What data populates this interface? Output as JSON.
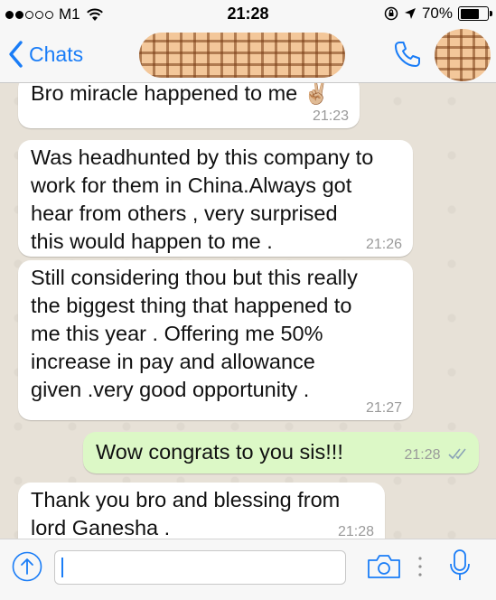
{
  "status_bar": {
    "carrier": "M1",
    "time": "21:28",
    "battery_percent": "70%",
    "battery_level": 0.7
  },
  "nav": {
    "back_label": "Chats"
  },
  "messages": [
    {
      "direction": "in",
      "lines": [
        "Bro miracle happened to me ✌🏼"
      ],
      "time": "21:23"
    },
    {
      "direction": "in",
      "lines": [
        "Was headhunted by this company to",
        "work for them in China.Always got",
        "hear from others , very surprised",
        "this would happen to me ."
      ],
      "time": "21:26"
    },
    {
      "direction": "in",
      "lines": [
        "Still considering thou but this really",
        "the biggest thing that happened to",
        "me this year . Offering me 50%",
        "increase in pay and allowance",
        "given .very good opportunity ."
      ],
      "time": "21:27"
    },
    {
      "direction": "out",
      "lines": [
        "Wow congrats to you sis!!!"
      ],
      "time": "21:28",
      "status": "read"
    },
    {
      "direction": "in",
      "lines": [
        "Thank you bro and blessing from",
        "lord Ganesha ."
      ],
      "time": "21:28"
    }
  ],
  "input": {
    "placeholder": ""
  },
  "colors": {
    "accent": "#1a7df7",
    "outgoing_bubble": "#dcf8c6",
    "incoming_bubble": "#ffffff",
    "chat_background": "#e7e1d7"
  }
}
